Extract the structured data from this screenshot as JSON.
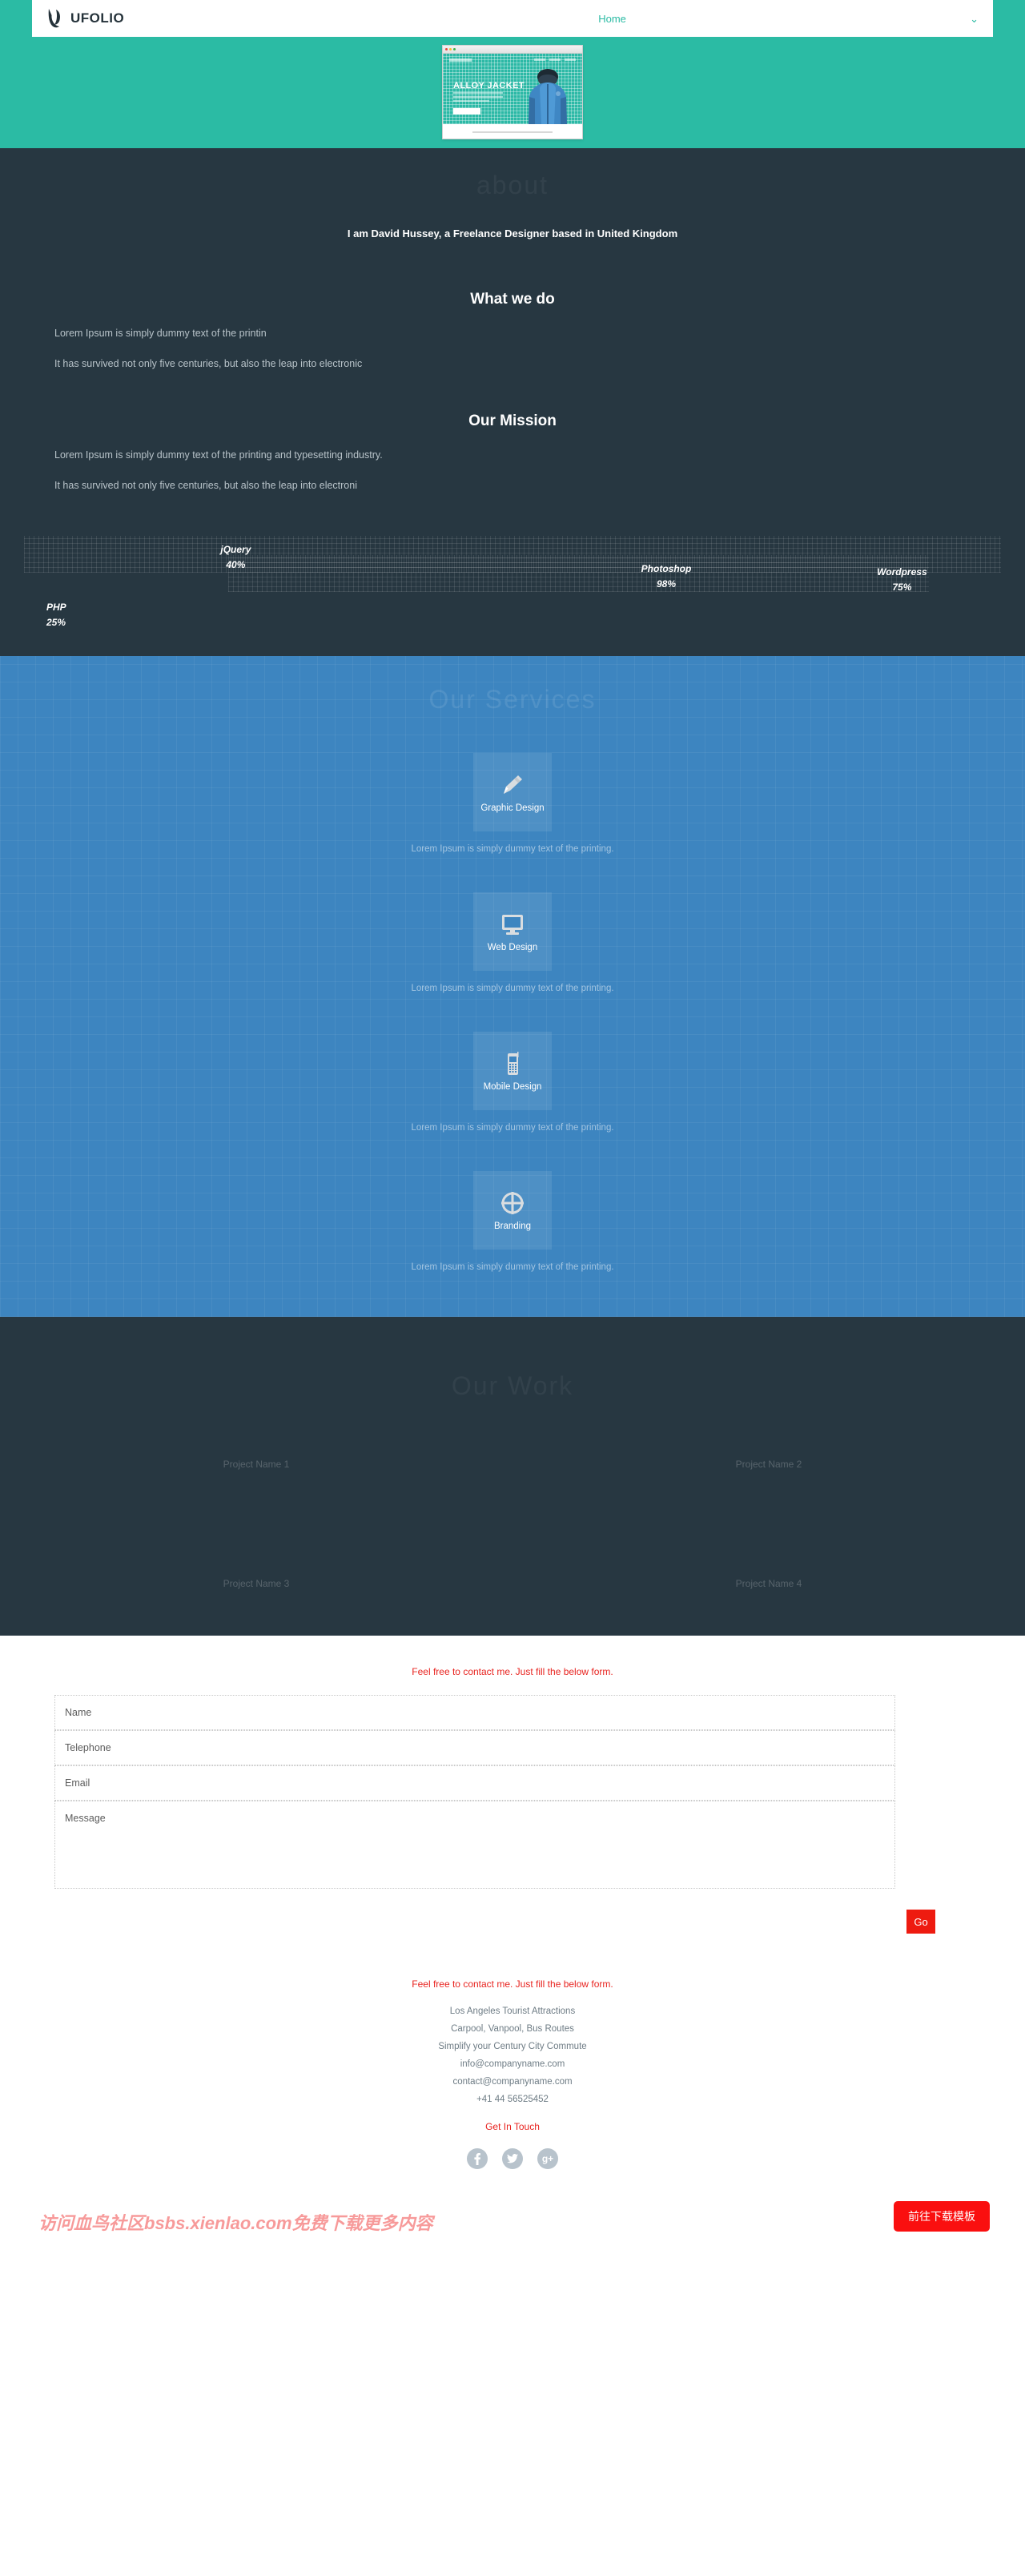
{
  "header": {
    "brand_name": "UFOLIO",
    "brand_icon": "ufolio-logo-icon",
    "nav_items": [
      {
        "label": "Home"
      }
    ],
    "caret_icon": "chevron-down-icon"
  },
  "hero": {
    "mockup_heading": "ALLOY JACKET",
    "background_color": "#2bbba4",
    "mockup_image_alt": "blue-alloy-jacket-product-photo"
  },
  "about": {
    "ghost_title": "about",
    "tagline": "I am David Hussey, a Freelance Designer based in United Kingdom",
    "blocks": [
      {
        "title": "What we do",
        "p1": "Lorem Ipsum is simply dummy text of the printin",
        "p2": "It has survived not only five centuries, but also the leap into electronic"
      },
      {
        "title": "Our Mission",
        "p1": "Lorem Ipsum is simply dummy text of the printing and typesetting industry.",
        "p2": "It has survived not only five centuries, but also the leap into electroni"
      }
    ]
  },
  "skills": [
    {
      "name": "jQuery",
      "percent": "40%",
      "value": 40,
      "center_pct": 23
    },
    {
      "name": "Photoshop",
      "percent": "98%",
      "value": 98,
      "center_pct": 65
    },
    {
      "name": "Wordpress",
      "percent": "75%",
      "value": 75,
      "center_pct": 88
    },
    {
      "name": "PHP",
      "percent": "25%",
      "value": 25,
      "center_pct": 4
    }
  ],
  "services": {
    "ghost_title": "Our Services",
    "items": [
      {
        "name": "Graphic Design",
        "icon": "pencil-icon",
        "desc": "Lorem Ipsum is simply dummy text of the printing."
      },
      {
        "name": "Web Design",
        "icon": "monitor-icon",
        "desc": "Lorem Ipsum is simply dummy text of the printing."
      },
      {
        "name": "Mobile Design",
        "icon": "mobile-phone-icon",
        "desc": "Lorem Ipsum is simply dummy text of the printing."
      },
      {
        "name": "Branding",
        "icon": "globe-crosshair-icon",
        "desc": "Lorem Ipsum is simply dummy text of the printing."
      }
    ]
  },
  "work": {
    "ghost_title": "Our Work",
    "projects": [
      {
        "name": "Project Name 1"
      },
      {
        "name": "Project Name 2"
      },
      {
        "name": "Project Name 3"
      },
      {
        "name": "Project Name 4"
      }
    ]
  },
  "contact": {
    "note": "Feel free to contact me. Just fill the below form.",
    "fields": {
      "name_placeholder": "Name",
      "telephone_placeholder": "Telephone",
      "email_placeholder": "Email",
      "message_placeholder": "Message"
    },
    "submit_label": "Go",
    "submit_color": "#ee1b10"
  },
  "footer": {
    "headline": "Feel free to contact me. Just fill the below form.",
    "lines": [
      "Los Angeles Tourist Attractions",
      "Carpool, Vanpool, Bus Routes",
      "Simplify your Century City Commute",
      "info@companyname.com",
      "contact@companyname.com",
      "+41 44 56525452"
    ],
    "cta": "Get In Touch",
    "socials": [
      {
        "name": "facebook",
        "glyph": "f"
      },
      {
        "name": "twitter",
        "glyph": "ᴗ"
      },
      {
        "name": "googleplus",
        "glyph": "g+"
      }
    ]
  },
  "watermark": {
    "text": "访问血鸟社区bsbs.xienlao.com免费下载更多内容",
    "button_label": "前往下载模板",
    "button_color": "#fa0f0f"
  }
}
